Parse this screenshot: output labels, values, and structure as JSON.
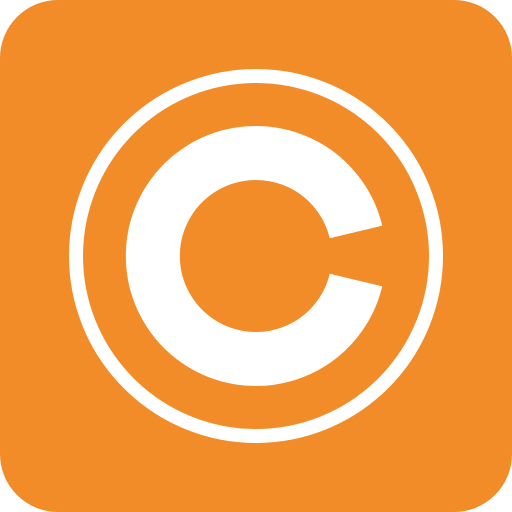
{
  "icon": {
    "symbol": "copyright-icon",
    "background_color": "#F28C28",
    "foreground_color": "#FFFFFF"
  }
}
